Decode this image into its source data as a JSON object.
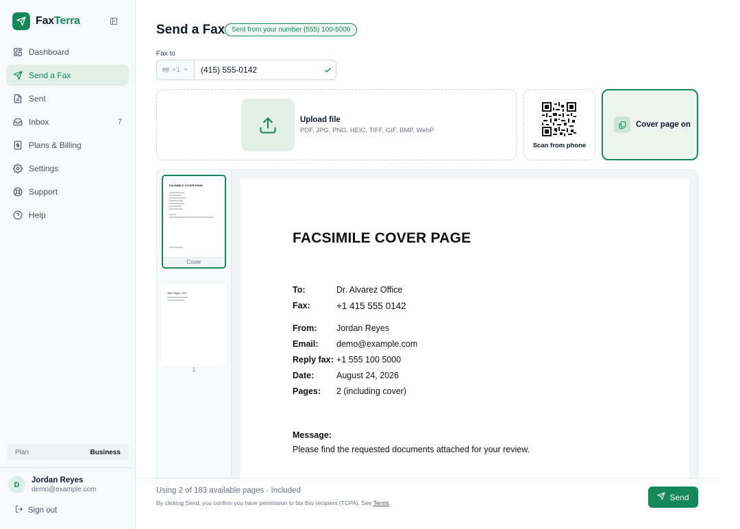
{
  "brand": {
    "name_part1": "Fax",
    "name_part2": "Terra"
  },
  "sidebar": {
    "items": [
      {
        "label": "Dashboard",
        "icon": "grid-icon"
      },
      {
        "label": "Send a Fax",
        "icon": "send-icon",
        "active": true
      },
      {
        "label": "Sent",
        "icon": "document-icon"
      },
      {
        "label": "Inbox",
        "icon": "inbox-icon",
        "count": "7"
      },
      {
        "label": "Plans & Billing",
        "icon": "billing-icon"
      },
      {
        "label": "Settings",
        "icon": "gear-icon"
      },
      {
        "label": "Support",
        "icon": "lifebuoy-icon"
      },
      {
        "label": "Help",
        "icon": "help-icon"
      }
    ],
    "plan": {
      "label": "Plan",
      "value": "Business"
    },
    "user": {
      "initial": "D",
      "name": "Jordan Reyes",
      "email": "demo@example.com"
    },
    "signout_label": "Sign out"
  },
  "header": {
    "title": "Send a Fax",
    "sender_badge": "Sent from your number (555) 100-5000"
  },
  "fax_to": {
    "label": "Fax to",
    "country_code": "+1",
    "number": "(415) 555-0142"
  },
  "upload": {
    "title": "Upload file",
    "types": "PDF, JPG, PNG, HEIC, TIFF, GIF, BMP, WebP",
    "scan_label": "Scan from phone",
    "cover_label": "Cover page on"
  },
  "thumbnails": [
    {
      "caption": "Cover",
      "heading": "FACSIMILE COVER PAGE"
    },
    {
      "caption": "1",
      "heading": "Test Page 1 of 1"
    }
  ],
  "cover_page": {
    "title": "FACSIMILE COVER PAGE",
    "to_label": "To:",
    "to": "Dr. Alvarez Office",
    "fax_label": "Fax:",
    "fax": "+1 415 555 0142",
    "from_label": "From:",
    "from": "Jordan Reyes",
    "email_label": "Email:",
    "email": "demo@example.com",
    "reply_label": "Reply fax:",
    "reply": "+1 555 100 5000",
    "date_label": "Date:",
    "date": "August 24, 2026",
    "pages_label": "Pages:",
    "pages": "2 (including cover)",
    "message_label": "Message:",
    "message": "Please find the requested documents attached for your review."
  },
  "footer": {
    "usage": "Using 2 of 183 available pages · Included",
    "consent": "By clicking Send, you confirm you have permission to fax this recipient (TCPA). See",
    "terms_link": "Terms",
    "send_label": "Send"
  },
  "colors": {
    "accent": "#16875a",
    "accent_soft": "#e3efe9"
  }
}
